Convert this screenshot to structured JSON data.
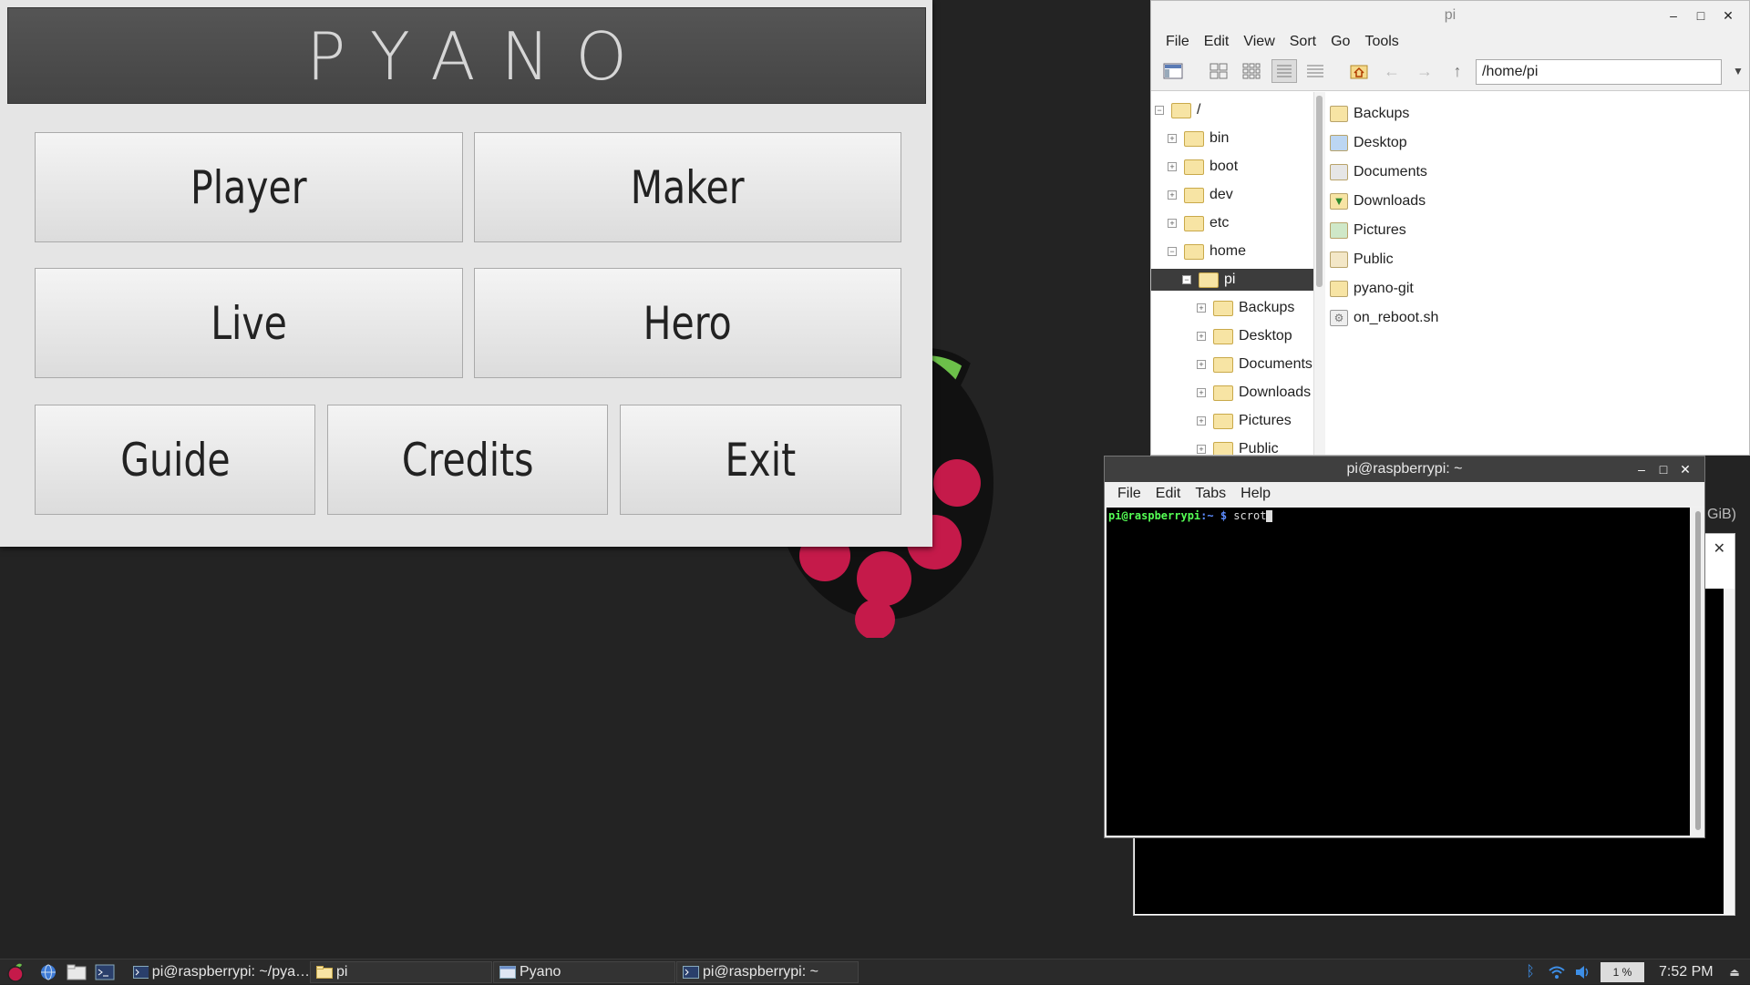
{
  "pyano": {
    "title": "PYANO",
    "buttons": {
      "player": "Player",
      "maker": "Maker",
      "live": "Live",
      "hero": "Hero",
      "guide": "Guide",
      "credits": "Credits",
      "exit": "Exit"
    }
  },
  "file_manager": {
    "title": "pi",
    "menu": [
      "File",
      "Edit",
      "View",
      "Sort",
      "Go",
      "Tools"
    ],
    "path": "/home/pi",
    "tree": [
      {
        "label": "/",
        "expander": "−",
        "level": 0
      },
      {
        "label": "bin",
        "expander": "+",
        "level": 1
      },
      {
        "label": "boot",
        "expander": "+",
        "level": 1
      },
      {
        "label": "dev",
        "expander": "+",
        "level": 1
      },
      {
        "label": "etc",
        "expander": "+",
        "level": 1
      },
      {
        "label": "home",
        "expander": "−",
        "level": 1
      },
      {
        "label": "pi",
        "expander": "−",
        "level": 2,
        "selected": true
      },
      {
        "label": "Backups",
        "expander": "+",
        "level": 3
      },
      {
        "label": "Desktop",
        "expander": "+",
        "level": 3
      },
      {
        "label": "Documents",
        "expander": "+",
        "level": 3
      },
      {
        "label": "Downloads",
        "expander": "+",
        "level": 3
      },
      {
        "label": "Pictures",
        "expander": "+",
        "level": 3
      },
      {
        "label": "Public",
        "expander": "+",
        "level": 3
      }
    ],
    "files": [
      {
        "name": "Backups",
        "icon": "folder-icon"
      },
      {
        "name": "Desktop",
        "icon": "desktop-folder-icon"
      },
      {
        "name": "Documents",
        "icon": "documents-folder-icon"
      },
      {
        "name": "Downloads",
        "icon": "downloads-folder-icon"
      },
      {
        "name": "Pictures",
        "icon": "pictures-folder-icon"
      },
      {
        "name": "Public",
        "icon": "public-folder-icon"
      },
      {
        "name": "pyano-git",
        "icon": "folder-icon"
      },
      {
        "name": "on_reboot.sh",
        "icon": "script-file-icon"
      }
    ]
  },
  "terminal": {
    "title": "pi@raspberrypi: ~",
    "menu": [
      "File",
      "Edit",
      "Tabs",
      "Help"
    ],
    "prompt_user": "pi@raspberrypi",
    "prompt_path": ":~ $",
    "command": "scrot"
  },
  "background_window": {
    "peek_text": "GiB)"
  },
  "taskbar": {
    "tasks": [
      {
        "label": "pi@raspberrypi: ~/pya…",
        "icon": "terminal-icon"
      },
      {
        "label": "pi",
        "icon": "folder-icon"
      },
      {
        "label": "Pyano",
        "icon": "window-icon"
      },
      {
        "label": "pi@raspberrypi: ~",
        "icon": "terminal-icon"
      }
    ],
    "cpu": "1 %",
    "clock": "7:52 PM"
  },
  "colors": {
    "raspberry": "#c51a4a",
    "leaf": "#6cc04a",
    "prompt_green": "#55ff55",
    "prompt_blue": "#5c8cff",
    "selection": "#3c3c3c"
  }
}
